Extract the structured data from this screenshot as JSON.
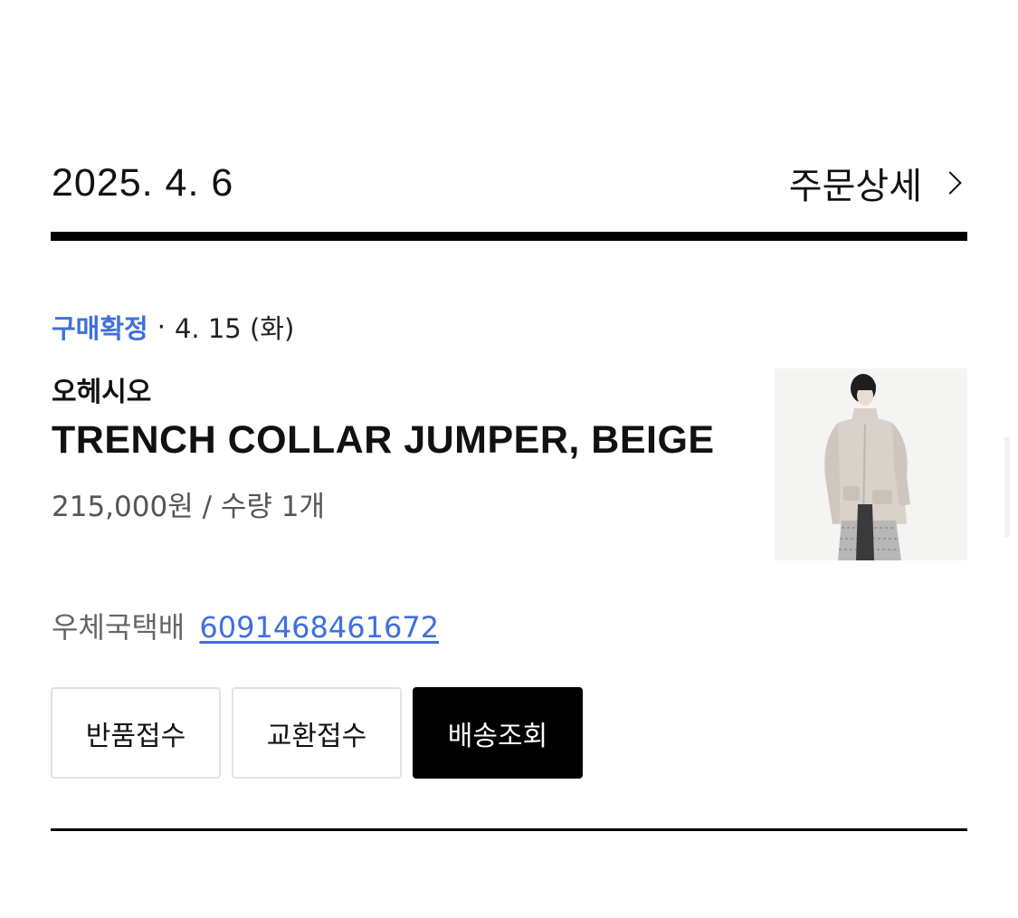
{
  "order": {
    "date": "2025. 4. 6",
    "detail_label": "주문상세"
  },
  "status": {
    "label": "구매확정",
    "separator": "·",
    "date": "4. 15 (화)",
    "color": "#3f6fe0"
  },
  "product": {
    "brand": "오헤시오",
    "name": "TRENCH COLLAR JUMPER, BEIGE",
    "price_qty": "215,000원 / 수량 1개",
    "image_icon": "product-photo"
  },
  "shipping": {
    "courier": "우체국택배",
    "tracking_number": "6091468461672"
  },
  "actions": {
    "return_label": "반품접수",
    "exchange_label": "교환접수",
    "track_label": "배송조회"
  }
}
